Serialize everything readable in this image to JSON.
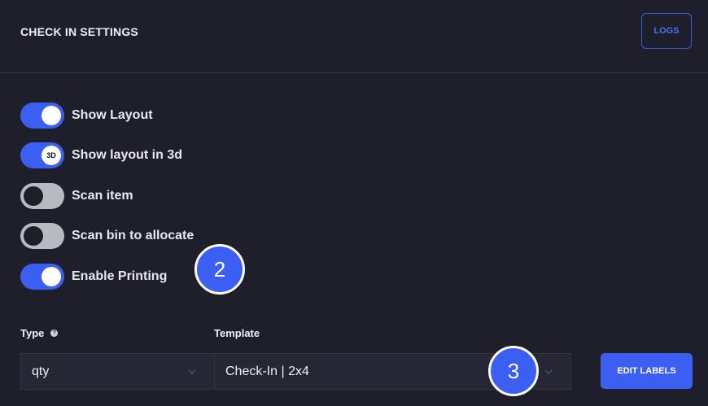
{
  "header": {
    "title": "CHECK IN SETTINGS",
    "logs_label": "LOGS"
  },
  "toggles": [
    {
      "label": "Show Layout",
      "state": "on",
      "knob_text": ""
    },
    {
      "label": "Show layout in 3d",
      "state": "on",
      "knob_text": "3D"
    },
    {
      "label": "Scan item",
      "state": "off",
      "knob_text": ""
    },
    {
      "label": "Scan bin to allocate",
      "state": "off",
      "knob_text": ""
    },
    {
      "label": "Enable Printing",
      "state": "on",
      "knob_text": ""
    }
  ],
  "type_field": {
    "label": "Type",
    "value": "qty"
  },
  "template_field": {
    "label": "Template",
    "value": "Check-In | 2x4"
  },
  "edit_labels": "EDIT LABELS",
  "badges": [
    "2",
    "3"
  ],
  "colors": {
    "accent": "#3b5ff2",
    "background": "#1f1f2c"
  }
}
